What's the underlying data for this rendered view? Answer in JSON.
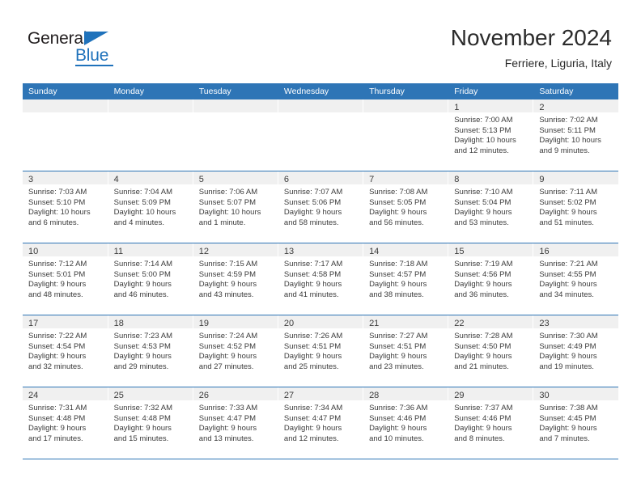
{
  "brand": {
    "name_part1": "General",
    "name_part2": "Blue",
    "accent_color": "#1f72bb"
  },
  "header": {
    "title": "November 2024",
    "subtitle": "Ferriere, Liguria, Italy"
  },
  "calendar": {
    "header_color": "#2e75b6",
    "weekday_headers": [
      "Sunday",
      "Monday",
      "Tuesday",
      "Wednesday",
      "Thursday",
      "Friday",
      "Saturday"
    ],
    "weeks": [
      [
        {
          "date": "",
          "lines": []
        },
        {
          "date": "",
          "lines": []
        },
        {
          "date": "",
          "lines": []
        },
        {
          "date": "",
          "lines": []
        },
        {
          "date": "",
          "lines": []
        },
        {
          "date": "1",
          "lines": [
            "Sunrise: 7:00 AM",
            "Sunset: 5:13 PM",
            "Daylight: 10 hours",
            "and 12 minutes."
          ]
        },
        {
          "date": "2",
          "lines": [
            "Sunrise: 7:02 AM",
            "Sunset: 5:11 PM",
            "Daylight: 10 hours",
            "and 9 minutes."
          ]
        }
      ],
      [
        {
          "date": "3",
          "lines": [
            "Sunrise: 7:03 AM",
            "Sunset: 5:10 PM",
            "Daylight: 10 hours",
            "and 6 minutes."
          ]
        },
        {
          "date": "4",
          "lines": [
            "Sunrise: 7:04 AM",
            "Sunset: 5:09 PM",
            "Daylight: 10 hours",
            "and 4 minutes."
          ]
        },
        {
          "date": "5",
          "lines": [
            "Sunrise: 7:06 AM",
            "Sunset: 5:07 PM",
            "Daylight: 10 hours",
            "and 1 minute."
          ]
        },
        {
          "date": "6",
          "lines": [
            "Sunrise: 7:07 AM",
            "Sunset: 5:06 PM",
            "Daylight: 9 hours",
            "and 58 minutes."
          ]
        },
        {
          "date": "7",
          "lines": [
            "Sunrise: 7:08 AM",
            "Sunset: 5:05 PM",
            "Daylight: 9 hours",
            "and 56 minutes."
          ]
        },
        {
          "date": "8",
          "lines": [
            "Sunrise: 7:10 AM",
            "Sunset: 5:04 PM",
            "Daylight: 9 hours",
            "and 53 minutes."
          ]
        },
        {
          "date": "9",
          "lines": [
            "Sunrise: 7:11 AM",
            "Sunset: 5:02 PM",
            "Daylight: 9 hours",
            "and 51 minutes."
          ]
        }
      ],
      [
        {
          "date": "10",
          "lines": [
            "Sunrise: 7:12 AM",
            "Sunset: 5:01 PM",
            "Daylight: 9 hours",
            "and 48 minutes."
          ]
        },
        {
          "date": "11",
          "lines": [
            "Sunrise: 7:14 AM",
            "Sunset: 5:00 PM",
            "Daylight: 9 hours",
            "and 46 minutes."
          ]
        },
        {
          "date": "12",
          "lines": [
            "Sunrise: 7:15 AM",
            "Sunset: 4:59 PM",
            "Daylight: 9 hours",
            "and 43 minutes."
          ]
        },
        {
          "date": "13",
          "lines": [
            "Sunrise: 7:17 AM",
            "Sunset: 4:58 PM",
            "Daylight: 9 hours",
            "and 41 minutes."
          ]
        },
        {
          "date": "14",
          "lines": [
            "Sunrise: 7:18 AM",
            "Sunset: 4:57 PM",
            "Daylight: 9 hours",
            "and 38 minutes."
          ]
        },
        {
          "date": "15",
          "lines": [
            "Sunrise: 7:19 AM",
            "Sunset: 4:56 PM",
            "Daylight: 9 hours",
            "and 36 minutes."
          ]
        },
        {
          "date": "16",
          "lines": [
            "Sunrise: 7:21 AM",
            "Sunset: 4:55 PM",
            "Daylight: 9 hours",
            "and 34 minutes."
          ]
        }
      ],
      [
        {
          "date": "17",
          "lines": [
            "Sunrise: 7:22 AM",
            "Sunset: 4:54 PM",
            "Daylight: 9 hours",
            "and 32 minutes."
          ]
        },
        {
          "date": "18",
          "lines": [
            "Sunrise: 7:23 AM",
            "Sunset: 4:53 PM",
            "Daylight: 9 hours",
            "and 29 minutes."
          ]
        },
        {
          "date": "19",
          "lines": [
            "Sunrise: 7:24 AM",
            "Sunset: 4:52 PM",
            "Daylight: 9 hours",
            "and 27 minutes."
          ]
        },
        {
          "date": "20",
          "lines": [
            "Sunrise: 7:26 AM",
            "Sunset: 4:51 PM",
            "Daylight: 9 hours",
            "and 25 minutes."
          ]
        },
        {
          "date": "21",
          "lines": [
            "Sunrise: 7:27 AM",
            "Sunset: 4:51 PM",
            "Daylight: 9 hours",
            "and 23 minutes."
          ]
        },
        {
          "date": "22",
          "lines": [
            "Sunrise: 7:28 AM",
            "Sunset: 4:50 PM",
            "Daylight: 9 hours",
            "and 21 minutes."
          ]
        },
        {
          "date": "23",
          "lines": [
            "Sunrise: 7:30 AM",
            "Sunset: 4:49 PM",
            "Daylight: 9 hours",
            "and 19 minutes."
          ]
        }
      ],
      [
        {
          "date": "24",
          "lines": [
            "Sunrise: 7:31 AM",
            "Sunset: 4:48 PM",
            "Daylight: 9 hours",
            "and 17 minutes."
          ]
        },
        {
          "date": "25",
          "lines": [
            "Sunrise: 7:32 AM",
            "Sunset: 4:48 PM",
            "Daylight: 9 hours",
            "and 15 minutes."
          ]
        },
        {
          "date": "26",
          "lines": [
            "Sunrise: 7:33 AM",
            "Sunset: 4:47 PM",
            "Daylight: 9 hours",
            "and 13 minutes."
          ]
        },
        {
          "date": "27",
          "lines": [
            "Sunrise: 7:34 AM",
            "Sunset: 4:47 PM",
            "Daylight: 9 hours",
            "and 12 minutes."
          ]
        },
        {
          "date": "28",
          "lines": [
            "Sunrise: 7:36 AM",
            "Sunset: 4:46 PM",
            "Daylight: 9 hours",
            "and 10 minutes."
          ]
        },
        {
          "date": "29",
          "lines": [
            "Sunrise: 7:37 AM",
            "Sunset: 4:46 PM",
            "Daylight: 9 hours",
            "and 8 minutes."
          ]
        },
        {
          "date": "30",
          "lines": [
            "Sunrise: 7:38 AM",
            "Sunset: 4:45 PM",
            "Daylight: 9 hours",
            "and 7 minutes."
          ]
        }
      ]
    ]
  }
}
